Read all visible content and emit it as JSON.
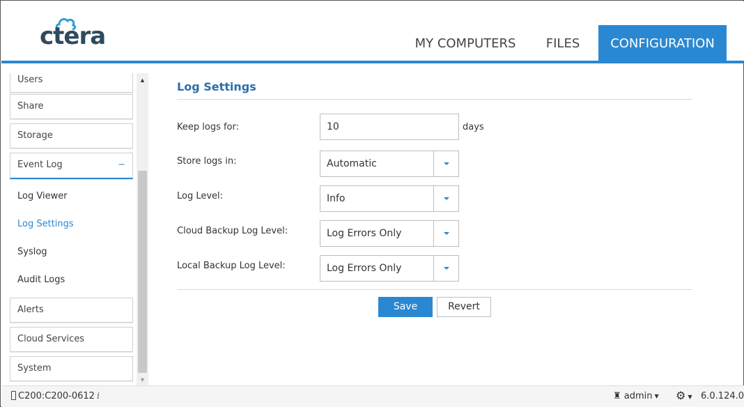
{
  "brand": {
    "logo_text": "ctera"
  },
  "nav": {
    "tabs": [
      {
        "label": "MY COMPUTERS"
      },
      {
        "label": "FILES"
      },
      {
        "label": "CONFIGURATION"
      }
    ]
  },
  "sidebar": {
    "items": [
      {
        "label": "Users"
      },
      {
        "label": "Share"
      },
      {
        "label": "Storage"
      },
      {
        "label": "Event Log",
        "toggle": "−"
      },
      {
        "label": "Alerts"
      },
      {
        "label": "Cloud Services"
      },
      {
        "label": "System"
      }
    ],
    "subitems": [
      {
        "label": "Log Viewer"
      },
      {
        "label": "Log Settings"
      },
      {
        "label": "Syslog"
      },
      {
        "label": "Audit Logs"
      }
    ]
  },
  "main": {
    "title": "Log Settings",
    "keep_logs": {
      "label": "Keep logs for:",
      "value": "10",
      "unit": "days"
    },
    "store_logs": {
      "label": "Store logs in:",
      "value": "Automatic"
    },
    "log_level": {
      "label": "Log Level:",
      "value": "Info"
    },
    "cloud_backup": {
      "label": "Cloud Backup Log Level:",
      "value": "Log Errors Only"
    },
    "local_backup": {
      "label": "Local Backup Log Level:",
      "value": "Log Errors Only"
    },
    "save_label": "Save",
    "revert_label": "Revert"
  },
  "footer": {
    "device": "C200:C200-0612",
    "info_icon": "i",
    "user": "admin",
    "version": "6.0.124.0"
  },
  "colors": {
    "accent": "#2a88d2",
    "title": "#2a6fa8",
    "logo": "#2e4a5f"
  }
}
